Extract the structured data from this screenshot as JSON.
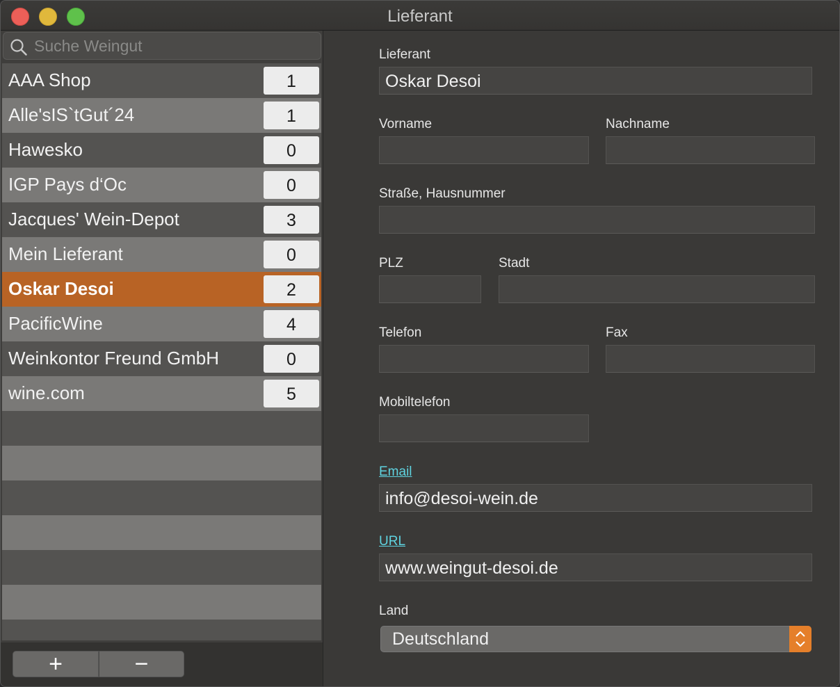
{
  "window": {
    "title": "Lieferant"
  },
  "search": {
    "placeholder": "Suche Weingut",
    "value": ""
  },
  "suppliers": [
    {
      "name": "AAA Shop",
      "count": "1"
    },
    {
      "name": "Alle'sIS`tGut´24",
      "count": "1"
    },
    {
      "name": "Hawesko",
      "count": "0"
    },
    {
      "name": "IGP Pays d‘Oc",
      "count": "0"
    },
    {
      "name": "Jacques' Wein-Depot",
      "count": "3"
    },
    {
      "name": "Mein Lieferant",
      "count": "0"
    },
    {
      "name": "Oskar Desoi",
      "count": "2",
      "selected": true
    },
    {
      "name": "PacificWine",
      "count": "4"
    },
    {
      "name": "Weinkontor Freund GmbH",
      "count": "0"
    },
    {
      "name": "wine.com",
      "count": "5"
    }
  ],
  "toolbar": {
    "add_label": "+",
    "remove_label": "−"
  },
  "form": {
    "lieferant_label": "Lieferant",
    "lieferant_value": "Oskar Desoi",
    "vorname_label": "Vorname",
    "vorname_value": "",
    "nachname_label": "Nachname",
    "nachname_value": "",
    "strasse_label": "Straße, Hausnummer",
    "strasse_value": "",
    "plz_label": "PLZ",
    "plz_value": "",
    "stadt_label": "Stadt",
    "stadt_value": "",
    "telefon_label": "Telefon",
    "telefon_value": "",
    "fax_label": "Fax",
    "fax_value": "",
    "mobil_label": "Mobiltelefon",
    "mobil_value": "",
    "email_label": "Email",
    "email_value": "info@desoi-wein.de",
    "url_label": "URL",
    "url_value": "www.weingut-desoi.de",
    "land_label": "Land",
    "land_value": "Deutschland"
  },
  "colors": {
    "accent": "#b86325",
    "link": "#5fd3e0",
    "select_arrow": "#e57f2a"
  }
}
